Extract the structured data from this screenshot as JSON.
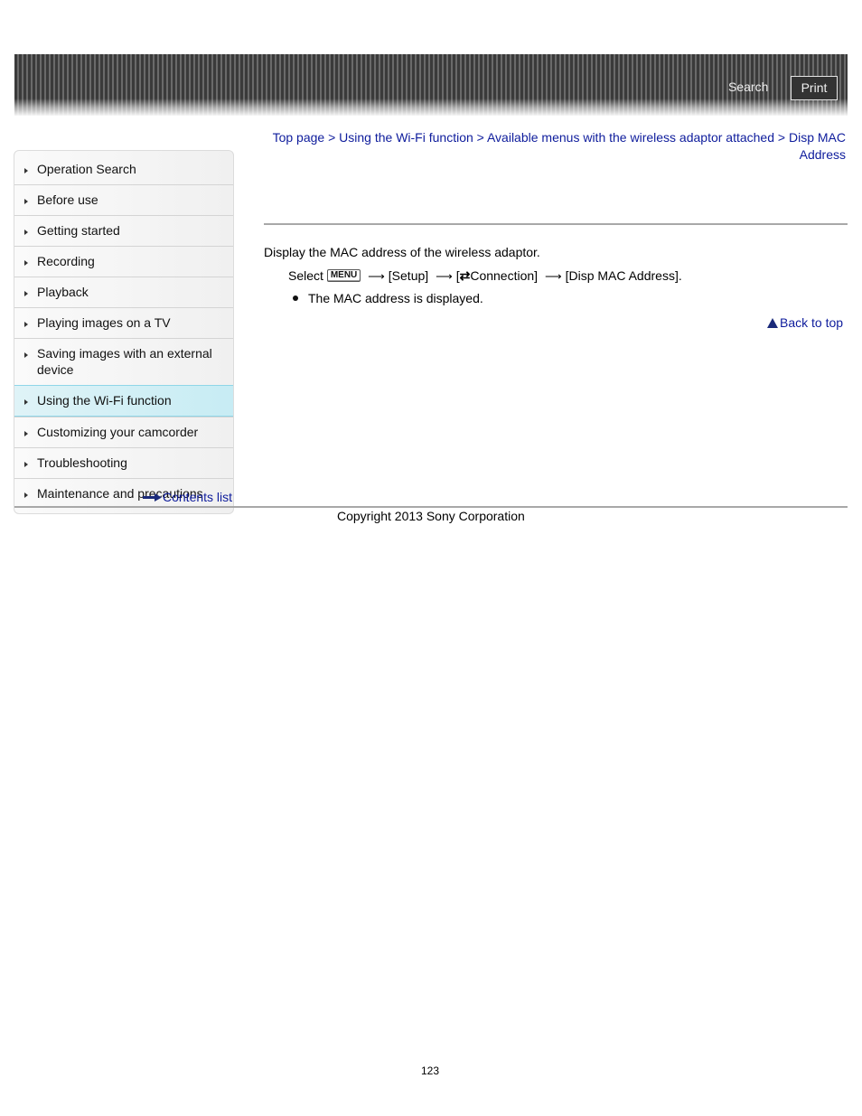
{
  "header": {
    "search_label": "Search",
    "print_label": "Print"
  },
  "sidebar": {
    "items": [
      {
        "label": "Operation Search",
        "active": false
      },
      {
        "label": "Before use",
        "active": false
      },
      {
        "label": "Getting started",
        "active": false
      },
      {
        "label": "Recording",
        "active": false
      },
      {
        "label": "Playback",
        "active": false
      },
      {
        "label": "Playing images on a TV",
        "active": false
      },
      {
        "label": "Saving images with an external device",
        "active": false
      },
      {
        "label": "Using the Wi-Fi function",
        "active": true
      },
      {
        "label": "Customizing your camcorder",
        "active": false
      },
      {
        "label": "Troubleshooting",
        "active": false
      },
      {
        "label": "Maintenance and precautions",
        "active": false
      }
    ],
    "contents_link": "Contents list"
  },
  "breadcrumb": {
    "items": [
      "Top page",
      "Using the Wi-Fi function",
      "Available menus with the wireless adaptor attached",
      "Disp MAC Address"
    ],
    "separator": ">"
  },
  "content": {
    "intro": "Display the MAC address of the wireless adaptor.",
    "step": {
      "select": "Select",
      "menu_button": "MENU",
      "arrow": "⟶",
      "setup": "[Setup]",
      "connection_prefix": "[",
      "connection_icon": "⇄",
      "connection": "Connection]",
      "disp_mac": "[Disp MAC Address]."
    },
    "bullet": "The MAC address is displayed.",
    "back_to_top": "Back to top"
  },
  "footer": {
    "copyright": "Copyright 2013 Sony Corporation",
    "page_number": "123"
  },
  "colors": {
    "link": "#0e1c9c",
    "active_nav": "#c7ecf4"
  }
}
